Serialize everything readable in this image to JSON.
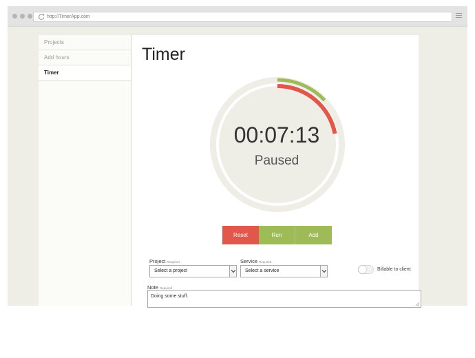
{
  "browser": {
    "url": "http://TimerApp.com",
    "icons": [
      "traffic-lights",
      "reload-icon",
      "hamburger-menu-icon"
    ]
  },
  "sidebar": {
    "items": [
      {
        "label": "Projects",
        "active": false
      },
      {
        "label": "Add hours",
        "active": false
      },
      {
        "label": "Timer",
        "active": true
      }
    ]
  },
  "main": {
    "title": "Timer",
    "timer": {
      "time": "00:07:13",
      "status": "Paused",
      "progress_red": 0.22,
      "progress_green": 0.13
    },
    "buttons": {
      "reset": "Reset",
      "run": "Run",
      "add": "Add"
    },
    "project": {
      "label": "Project",
      "required": "Required",
      "value": "Select a project"
    },
    "service": {
      "label": "Service",
      "required": "Required",
      "value": "Select a service"
    },
    "billable": {
      "label": "Billable to client",
      "checked": false
    },
    "note": {
      "label": "Note",
      "required": "Required",
      "value": "Doing some stuff."
    }
  },
  "colors": {
    "red": "#e2574c",
    "green": "#9fbb58",
    "ring": "#eeede6"
  }
}
